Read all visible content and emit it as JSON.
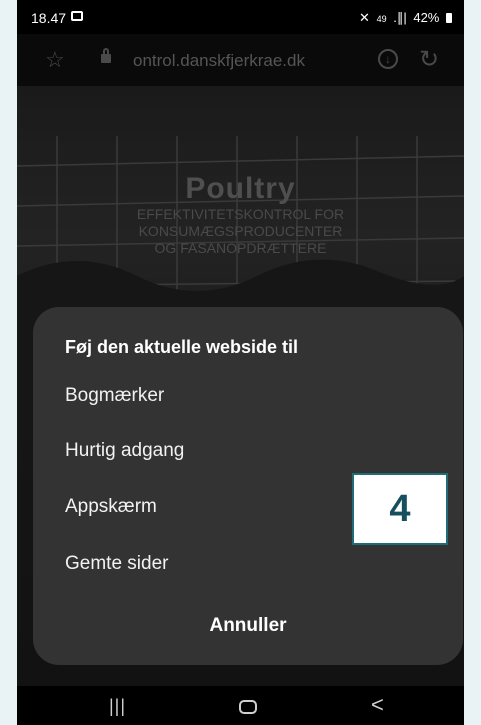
{
  "statusbar": {
    "time": "18.47",
    "signal_text": "◿ 49 .∥|",
    "network": "49",
    "signal_bars": ".∥|",
    "battery": "42%"
  },
  "browser": {
    "url": "ontrol.danskfjerkrae.dk"
  },
  "webpage": {
    "title": "Poultry",
    "subtitle_lines": [
      "EFFEKTIVITETSKONTROL FOR",
      "KONSUMÆGSPRODUCENTER",
      "OG FASANOPDRÆTTERE"
    ]
  },
  "sheet": {
    "title": "Føj den aktuelle webside til",
    "options": [
      "Bogmærker",
      "Hurtig adgang",
      "Appskærm",
      "Gemte sider"
    ],
    "cancel": "Annuller"
  },
  "navbar": {
    "recent_glyph": "|||",
    "back_glyph": "<"
  },
  "badge": {
    "label": "4"
  }
}
